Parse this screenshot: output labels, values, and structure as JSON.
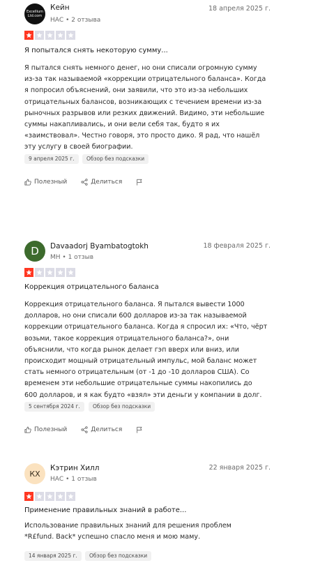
{
  "reviews": [
    {
      "avatar_lines": [
        "Excellium",
        "Ltd.com"
      ],
      "name": "Кейн",
      "meta": "НАС • 2 отзыва",
      "date": "18 апреля 2025 г.",
      "rating": 1,
      "rating_max": 5,
      "title": "Я попытался снять некоторую сумму...",
      "body_lines": [
        "Я пытался снять немного денег, но они списали огромную сумму",
        "из-за так называемой «коррекции отрицательного баланса». Когда",
        "я попросил объяснений, они заявили, что это из-за небольших",
        "отрицательных балансов, возникающих с течением времени из-за",
        "рыночных разрывов или резких движений. Видимо, эти небольшие",
        "суммы накапливались, и они вели себя так, будто я их",
        "«заимствовал». Честно говоря, это просто дико. Я рад, что нашёл",
        "эту услугу в своей биографии."
      ],
      "experience_date": "9 апреля 2025 г.",
      "badge": "Обзор без подсказки",
      "useful_label": "Полезный",
      "share_label": "Делиться"
    },
    {
      "avatar_initial": "D",
      "name": "Davaadorj Byambatogtokh",
      "meta": "MH • 1 отзыв",
      "date": "18 февраля 2025 г.",
      "rating": 1,
      "rating_max": 5,
      "title": "Коррекция отрицательного баланса",
      "body_lines": [
        "Коррекция отрицательного баланса. Я пытался вывести 1000",
        "долларов, но они списали 600 долларов из-за так называемой",
        "коррекции отрицательного баланса. Когда я спросил их: «Что, чёрт",
        "возьми, такое коррекция отрицательного баланса?», они",
        "объяснили, что когда рынок делает гэп вверх или вниз, или",
        "происходит мощный отрицательный импульс, мой баланс может",
        "стать немного отрицательным (от -1 до -10 долларов США). Со",
        "временем эти небольшие отрицательные суммы накопились до",
        "600 долларов, и я как будто «взял» эти деньги у компании в долг."
      ],
      "experience_date": "5 сентября 2024 г.",
      "badge": "Обзор без подсказки",
      "useful_label": "Полезный",
      "share_label": "Делиться"
    },
    {
      "avatar_initial": "КХ",
      "name": "Кэтрин Хилл",
      "meta": "НАС • 1 отзыв",
      "date": "22 января 2025 г.",
      "rating": 1,
      "rating_max": 5,
      "title": "Применение правильных знаний в работе...",
      "body_lines": [
        "Использование правильных знаний для решения проблем",
        "*R£fund. Back* успешно спасло меня и мою маму."
      ],
      "experience_date": "14 января 2025 г.",
      "badge": "Обзор без подсказки"
    }
  ],
  "colors": {
    "star_on": "#ff3722",
    "star_off": "#dcdce6",
    "avatar_d": "#3d6b2d",
    "avatar_kh": "#fbe2bf"
  }
}
